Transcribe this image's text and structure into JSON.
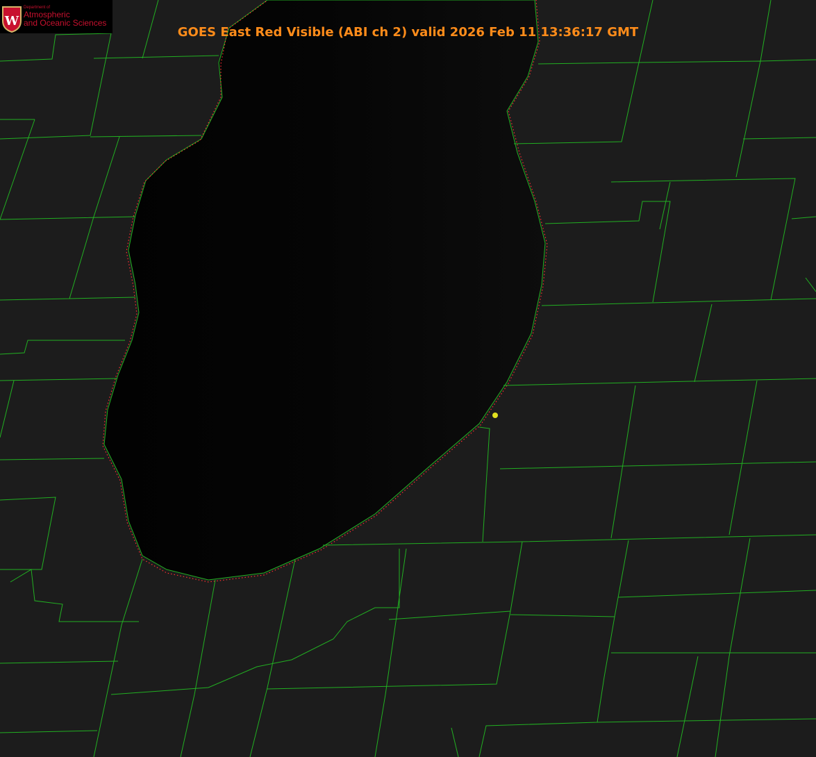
{
  "title": "GOES East Red Visible (ABI ch 2) valid 2026 Feb 11 13:36:17 GMT",
  "logo": {
    "line1": "Department of",
    "line2": "Atmospheric",
    "line3": "and Oceanic Sciences",
    "shield_letter": "W"
  },
  "colors": {
    "title": "#ff8c1a",
    "county_lines": "#22b022",
    "shoreline_dots": "#ff3030",
    "marker": "#e0e020",
    "land": "#1c1c1c",
    "lake": "#050505"
  }
}
